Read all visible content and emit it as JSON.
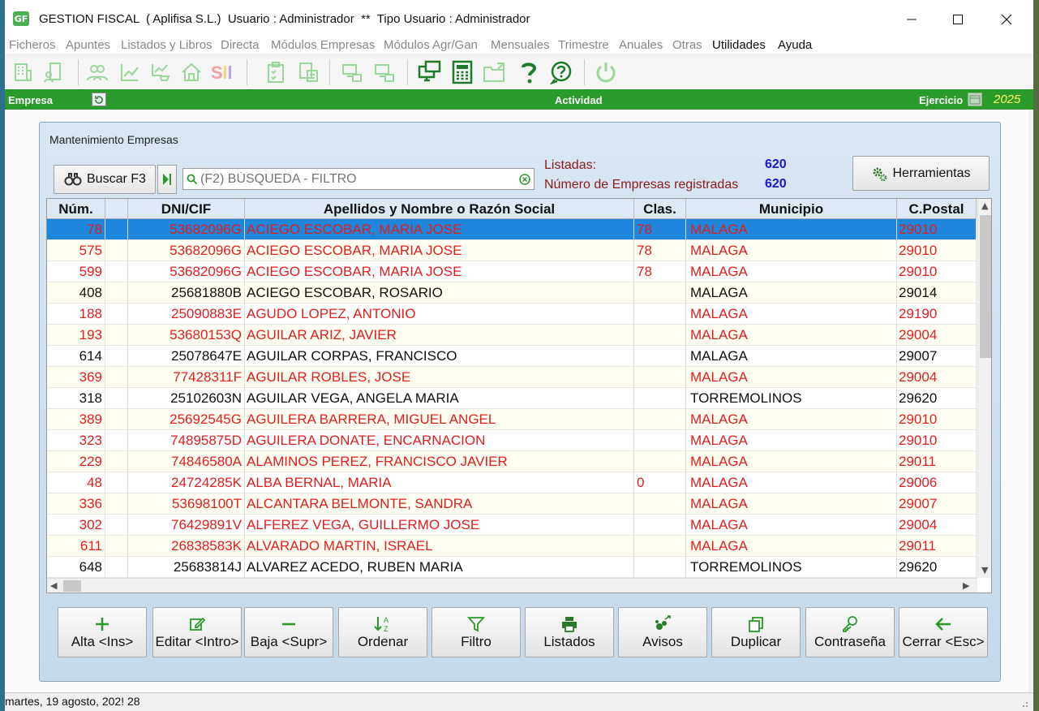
{
  "window": {
    "title": "GESTION FISCAL  ( Aplifisa S.L.)  Usuario : Administrador  **  Tipo Usuario : Administrador",
    "logo": "GF"
  },
  "menu": [
    {
      "label": "Ficheros",
      "active": false
    },
    {
      "label": "Apuntes",
      "active": false
    },
    {
      "label": "Listados y Libros",
      "active": false
    },
    {
      "label": "Directa",
      "active": false
    },
    {
      "label": "Módulos Empresas",
      "active": false
    },
    {
      "label": "Módulos Agr/Gan",
      "active": false
    },
    {
      "label": "Mensuales",
      "active": false
    },
    {
      "label": "Trimestre",
      "active": false
    },
    {
      "label": "Anuales",
      "active": false
    },
    {
      "label": "Otras",
      "active": false
    },
    {
      "label": "Utilidades",
      "active": true
    },
    {
      "label": "Ayuda",
      "active": true
    }
  ],
  "company_bar": {
    "empresa": "Empresa",
    "actividad": "Actividad",
    "ejercicio": "Ejercicio",
    "year": "2025"
  },
  "panel": {
    "title": "Mantenimiento Empresas",
    "search_button": "Buscar F3",
    "search_placeholder": "(F2) BÚSQUEDA - FILTRO",
    "listadas_label": "Listadas:",
    "listadas_value": "620",
    "registradas_label": "Número de Empresas registradas",
    "registradas_value": "620",
    "tools_button": "Herramientas"
  },
  "columns": {
    "num": "Núm.",
    "dni": "DNI/CIF",
    "name": "Apellidos y Nombre o Razón Social",
    "clas": "Clas.",
    "mun": "Municipio",
    "cp": "C.Postal"
  },
  "rows": [
    {
      "num": "78",
      "dni": "53682096G",
      "name": "ACIEGO ESCOBAR, MARIA JOSE",
      "clas": "78",
      "mun": "MALAGA",
      "cp": "29010",
      "red": true,
      "selected": true
    },
    {
      "num": "575",
      "dni": "53682096G",
      "name": "ACIEGO ESCOBAR, MARIA JOSE",
      "clas": "78",
      "mun": "MALAGA",
      "cp": "29010",
      "red": true
    },
    {
      "num": "599",
      "dni": "53682096G",
      "name": "ACIEGO ESCOBAR, MARIA JOSE",
      "clas": "78",
      "mun": "MALAGA",
      "cp": "29010",
      "red": true
    },
    {
      "num": "408",
      "dni": "25681880B",
      "name": "ACIEGO ESCOBAR, ROSARIO",
      "clas": "",
      "mun": "MALAGA",
      "cp": "29014",
      "red": false
    },
    {
      "num": "188",
      "dni": "25090883E",
      "name": "AGUDO LOPEZ, ANTONIO",
      "clas": "",
      "mun": "MALAGA",
      "cp": "29190",
      "red": true
    },
    {
      "num": "193",
      "dni": "53680153Q",
      "name": "AGUILAR ARIZ, JAVIER",
      "clas": "",
      "mun": "MALAGA",
      "cp": "29004",
      "red": true
    },
    {
      "num": "614",
      "dni": "25078647E",
      "name": "AGUILAR CORPAS, FRANCISCO",
      "clas": "",
      "mun": "MALAGA",
      "cp": "29007",
      "red": false
    },
    {
      "num": "369",
      "dni": "77428311F",
      "name": "AGUILAR ROBLES, JOSE",
      "clas": "",
      "mun": "MALAGA",
      "cp": "29004",
      "red": true
    },
    {
      "num": "318",
      "dni": "25102603N",
      "name": "AGUILAR VEGA, ANGELA MARIA",
      "clas": "",
      "mun": "TORREMOLINOS",
      "cp": "29620",
      "red": false
    },
    {
      "num": "389",
      "dni": "25692545G",
      "name": "AGUILERA BARRERA, MIGUEL ANGEL",
      "clas": "",
      "mun": "MALAGA",
      "cp": "29010",
      "red": true
    },
    {
      "num": "323",
      "dni": "74895875D",
      "name": "AGUILERA DONATE, ENCARNACION",
      "clas": "",
      "mun": "MALAGA",
      "cp": "29010",
      "red": true
    },
    {
      "num": "229",
      "dni": "74846580A",
      "name": "ALAMINOS PEREZ, FRANCISCO JAVIER",
      "clas": "",
      "mun": "MALAGA",
      "cp": "29011",
      "red": true
    },
    {
      "num": "48",
      "dni": "24724285K",
      "name": "ALBA BERNAL, MARIA",
      "clas": "0",
      "mun": "MALAGA",
      "cp": "29006",
      "red": true
    },
    {
      "num": "336",
      "dni": "53698100T",
      "name": "ALCANTARA BELMONTE, SANDRA",
      "clas": "",
      "mun": "MALAGA",
      "cp": "29007",
      "red": true
    },
    {
      "num": "302",
      "dni": "76429891V",
      "name": "ALFEREZ VEGA, GUILLERMO JOSE",
      "clas": "",
      "mun": "MALAGA",
      "cp": "29004",
      "red": true
    },
    {
      "num": "611",
      "dni": "26838583K",
      "name": "ALVARADO MARTIN, ISRAEL",
      "clas": "",
      "mun": "MALAGA",
      "cp": "29011",
      "red": true
    },
    {
      "num": "648",
      "dni": "25683814J",
      "name": "ALVAREZ ACEDO, RUBEN MARIA",
      "clas": "",
      "mun": "TORREMOLINOS",
      "cp": "29620",
      "red": false
    }
  ],
  "actions": [
    {
      "name": "alta-button",
      "label": "Alta <Ins>",
      "icon": "plus-icon"
    },
    {
      "name": "editar-button",
      "label": "Editar <Intro>",
      "icon": "edit-icon"
    },
    {
      "name": "baja-button",
      "label": "Baja <Supr>",
      "icon": "minus-icon"
    },
    {
      "name": "ordenar-button",
      "label": "Ordenar",
      "icon": "sort-icon"
    },
    {
      "name": "filtro-button",
      "label": "Filtro",
      "icon": "filter-icon"
    },
    {
      "name": "listados-button",
      "label": "Listados",
      "icon": "printer-icon"
    },
    {
      "name": "avisos-button",
      "label": "Avisos",
      "icon": "notices-icon"
    },
    {
      "name": "duplicar-button",
      "label": "Duplicar",
      "icon": "copy-icon"
    },
    {
      "name": "contrasena-button",
      "label": "Contraseña",
      "icon": "key-icon"
    },
    {
      "name": "cerrar-button",
      "label": "Cerrar <Esc>",
      "icon": "arrow-left-icon"
    }
  ],
  "status": "martes, 19 agosto, 202! 28",
  "colors": {
    "green_bar": "#2a9a2a",
    "selected_row": "#1e86dd",
    "red_text": "#e02020",
    "year": "#ffff66"
  }
}
